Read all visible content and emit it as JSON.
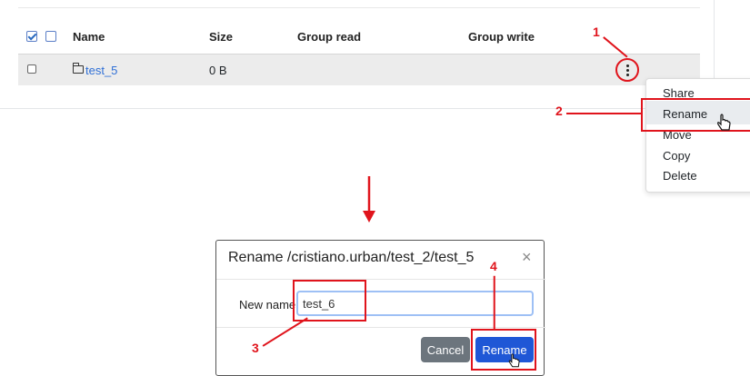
{
  "table": {
    "headers": {
      "name": "Name",
      "size": "Size",
      "group_read": "Group read",
      "group_write": "Group write"
    },
    "rows": [
      {
        "name": "test_5",
        "size": "0 B",
        "group_read": "",
        "group_write": ""
      }
    ]
  },
  "menu": {
    "items": [
      "Share",
      "Rename",
      "Move",
      "Copy",
      "Delete"
    ],
    "highlighted": "Rename"
  },
  "steps": [
    "1",
    "2",
    "3",
    "4"
  ],
  "modal": {
    "title": "Rename /cristiano.urban/test_2/test_5",
    "close": "×",
    "field_label": "New name",
    "field_value": "test_6",
    "cancel_label": "Cancel",
    "rename_label": "Rename"
  },
  "colors": {
    "annotation": "#e0141c",
    "primary": "#1f57d6",
    "secondary": "#6c757d",
    "link": "#2f6fd6"
  },
  "icons": {
    "folder": "folder-icon",
    "kebab": "kebab-menu-icon",
    "cursor": "hand-pointer-icon",
    "arrow": "arrow-down-icon"
  }
}
